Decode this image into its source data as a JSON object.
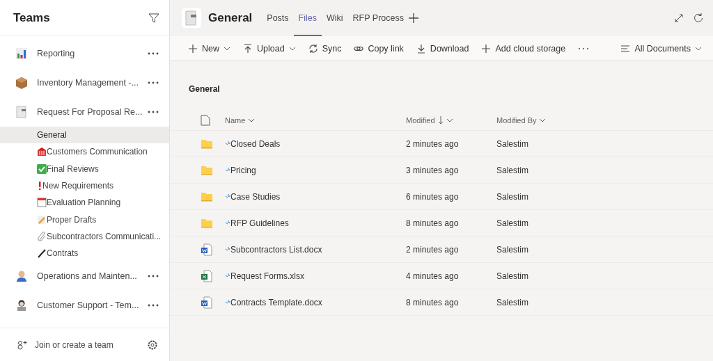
{
  "sidebar": {
    "title": "Teams",
    "teams": [
      {
        "name": "Reporting",
        "kind": "chart"
      },
      {
        "name": "Inventory Management -...",
        "kind": "box"
      },
      {
        "name": "Request For Proposal Re...",
        "kind": "document",
        "channels": [
          {
            "name": "General",
            "selected": true
          },
          {
            "name": "Customers Communication",
            "kind": "bank",
            "selected": false
          },
          {
            "name": "Final Reviews",
            "kind": "check",
            "selected": false
          },
          {
            "name": "New Requirements",
            "kind": "exclamation",
            "selected": false
          },
          {
            "name": "Evaluation Planning",
            "kind": "calendar",
            "selected": false
          },
          {
            "name": "Proper Drafts",
            "kind": "memo",
            "selected": false
          },
          {
            "name": "Subcontractors Communicati...",
            "kind": "paperclip",
            "selected": false
          },
          {
            "name": "Contrats",
            "kind": "pen",
            "selected": false
          }
        ]
      },
      {
        "name": "Operations and Mainten...",
        "kind": "worker"
      },
      {
        "name": "Customer Support - Tem...",
        "kind": "laptop"
      }
    ],
    "footer": "Join or create a team"
  },
  "channel_header": {
    "title": "General",
    "tabs": [
      {
        "label": "Posts",
        "selected": false
      },
      {
        "label": "Files",
        "selected": true
      },
      {
        "label": "Wiki",
        "selected": false
      },
      {
        "label": "RFP Process",
        "selected": false
      }
    ]
  },
  "toolbar": {
    "actions": [
      {
        "label": "New",
        "kind": "plus",
        "dropdown": true
      },
      {
        "label": "Upload",
        "kind": "upload",
        "dropdown": true
      },
      {
        "label": "Sync",
        "kind": "sync",
        "dropdown": false
      },
      {
        "label": "Copy link",
        "kind": "link",
        "dropdown": false
      },
      {
        "label": "Download",
        "kind": "download",
        "dropdown": false
      },
      {
        "label": "Add cloud storage",
        "kind": "plus",
        "dropdown": false
      }
    ],
    "view": "All Documents"
  },
  "breadcrumb": "General",
  "table": {
    "columns": [
      {
        "label": "Name",
        "sorted": false
      },
      {
        "label": "Modified",
        "sorted": true
      },
      {
        "label": "Modified By",
        "sorted": false
      }
    ],
    "rows": [
      {
        "kind": "folder",
        "name": "Closed Deals",
        "modified": "2 minutes ago",
        "modified_by": "Salestim"
      },
      {
        "kind": "folder",
        "name": "Pricing",
        "modified": "3 minutes ago",
        "modified_by": "Salestim"
      },
      {
        "kind": "folder",
        "name": "Case Studies",
        "modified": "6 minutes ago",
        "modified_by": "Salestim"
      },
      {
        "kind": "folder",
        "name": "RFP Guidelines",
        "modified": "8 minutes ago",
        "modified_by": "Salestim"
      },
      {
        "kind": "word",
        "name": "Subcontractors List.docx",
        "modified": "2 minutes ago",
        "modified_by": "Salestim"
      },
      {
        "kind": "excel",
        "name": "Request Forms.xlsx",
        "modified": "4 minutes ago",
        "modified_by": "Salestim"
      },
      {
        "kind": "word",
        "name": "Contracts Template.docx",
        "modified": "8 minutes ago",
        "modified_by": "Salestim"
      }
    ]
  }
}
